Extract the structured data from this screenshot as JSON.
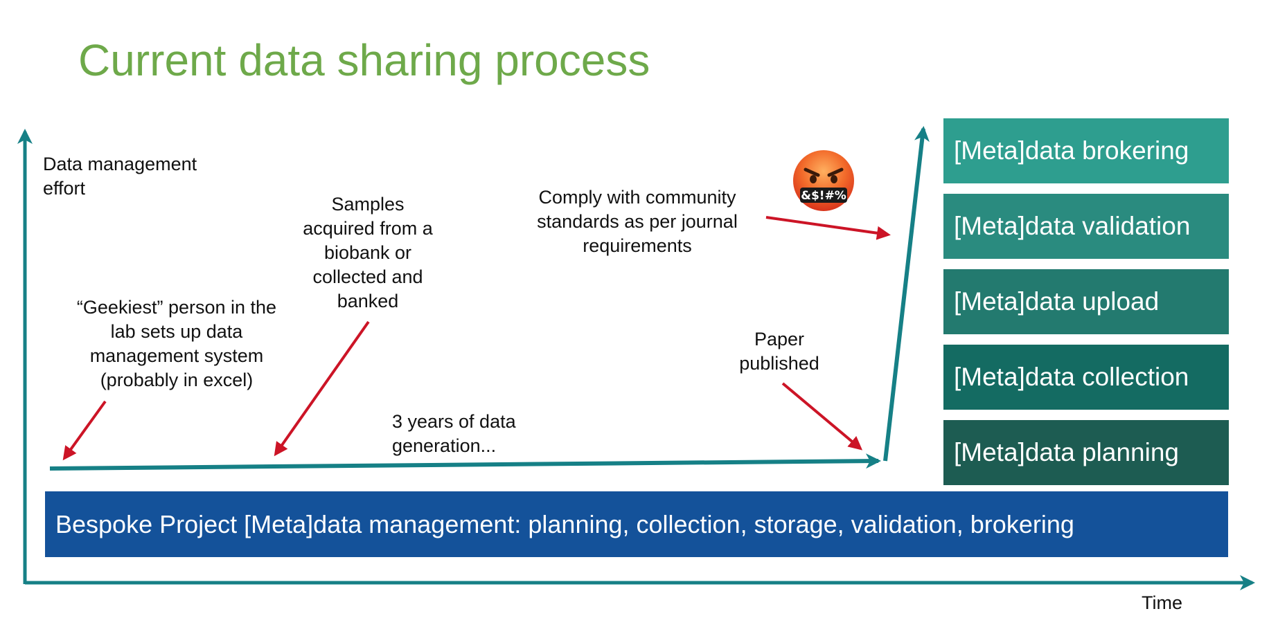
{
  "title": "Current data sharing process",
  "axes": {
    "y_label": [
      "Data management",
      "effort"
    ],
    "x_label": "Time"
  },
  "annotations": {
    "geekiest": [
      "“Geekiest” person in the",
      "lab sets up data",
      "management system",
      "(probably in excel)"
    ],
    "samples": [
      "Samples",
      "acquired from a",
      "biobank or",
      "collected and",
      "banked"
    ],
    "years": [
      "3 years of data",
      "generation..."
    ],
    "comply": [
      "Comply with community",
      "standards as per journal",
      "requirements"
    ],
    "paper": [
      "Paper",
      "published"
    ]
  },
  "emoji": {
    "name": "angry-face-with-symbols-icon",
    "symbols": "&$!#%"
  },
  "stack": [
    {
      "label": "[Meta]data brokering",
      "color": "#2e9e8f"
    },
    {
      "label": "[Meta]data validation",
      "color": "#2a8b7f"
    },
    {
      "label": "[Meta]data upload",
      "color": "#237a6f"
    },
    {
      "label": "[Meta]data collection",
      "color": "#146b62"
    },
    {
      "label": "[Meta]data planning",
      "color": "#1d5c52"
    }
  ],
  "bar_label": "Bespoke Project [Meta]data management: planning, collection, storage, validation, brokering",
  "colors": {
    "teal": "#168086",
    "red": "#cc1426",
    "title_green": "#6ea94a",
    "bar_blue": "#14529a"
  }
}
